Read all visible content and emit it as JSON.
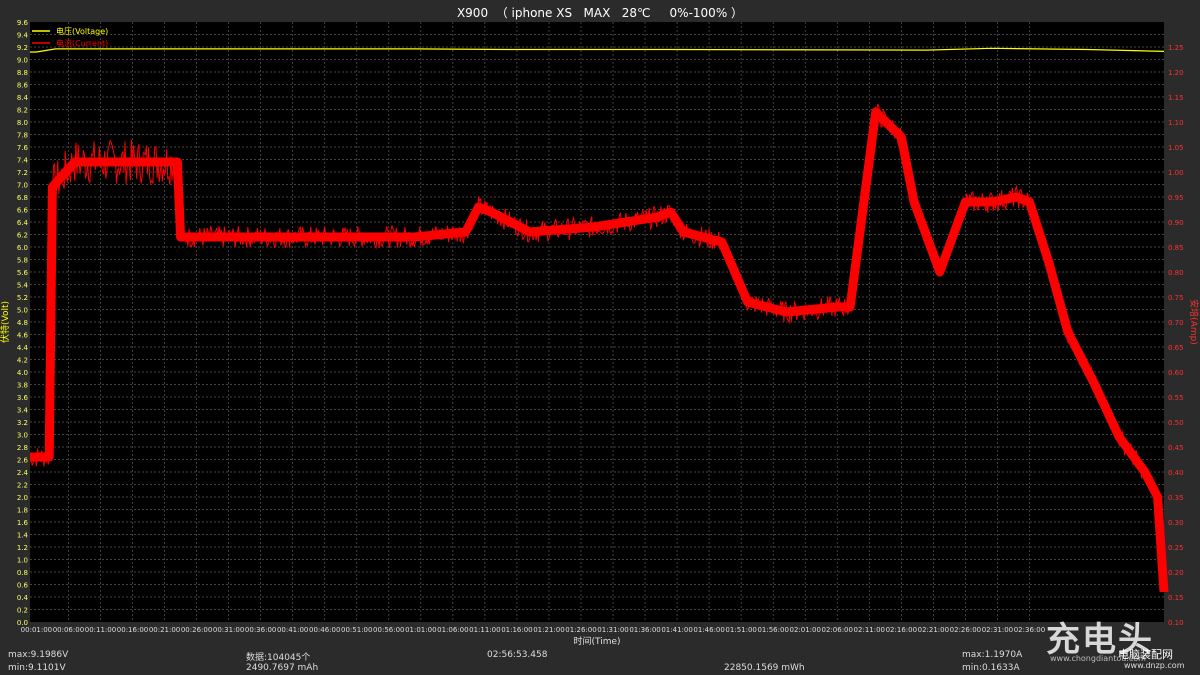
{
  "chart_data": {
    "type": "line",
    "title": "X900  （ iphone XS   MAX   28℃     0%-100% ）",
    "xlabel": "时间(Time)",
    "ylabel_left": "伏特(Volt)",
    "ylabel_right": "安培(Amp)",
    "y_left_range": [
      0,
      9.6
    ],
    "y_right_range": [
      0.1,
      1.3
    ],
    "y_left_ticks": [
      "0.0",
      "0.2",
      "0.4",
      "0.6",
      "0.8",
      "1.0",
      "1.2",
      "1.4",
      "1.6",
      "1.8",
      "2.0",
      "2.2",
      "2.4",
      "2.6",
      "2.8",
      "3.0",
      "3.2",
      "3.4",
      "3.6",
      "3.8",
      "4.0",
      "4.2",
      "4.4",
      "4.6",
      "4.8",
      "5.0",
      "5.2",
      "5.4",
      "5.6",
      "5.8",
      "6.0",
      "6.2",
      "6.4",
      "6.6",
      "6.8",
      "7.0",
      "7.2",
      "7.4",
      "7.6",
      "7.8",
      "8.0",
      "8.2",
      "8.4",
      "8.6",
      "8.8",
      "9.0",
      "9.2",
      "9.4",
      "9.6"
    ],
    "y_right_ticks": [
      "0.10",
      "0.15",
      "0.20",
      "0.25",
      "0.30",
      "0.35",
      "0.40",
      "0.45",
      "0.50",
      "0.55",
      "0.60",
      "0.65",
      "0.70",
      "0.75",
      "0.80",
      "0.85",
      "0.90",
      "0.95",
      "1.00",
      "1.05",
      "1.10",
      "1.15",
      "1.20",
      "1.25"
    ],
    "x_ticks": [
      "00:01:00",
      "00:06:00",
      "00:11:00",
      "00:16:00",
      "00:21:00",
      "00:26:00",
      "00:31:00",
      "00:36:00",
      "00:41:00",
      "00:46:00",
      "00:51:00",
      "00:56:00",
      "01:01:00",
      "01:06:00",
      "01:11:00",
      "01:16:00",
      "01:21:00",
      "01:26:00",
      "01:31:00",
      "01:36:00",
      "01:41:00",
      "01:46:00",
      "01:51:00",
      "01:56:00",
      "02:01:00",
      "02:06:00",
      "02:11:00",
      "02:16:00",
      "02:21:00",
      "02:26:00",
      "02:31:00",
      "02:36:00"
    ],
    "x_range_min": [
      0,
      177
    ],
    "grid": true,
    "legend_position": "top-left",
    "series": [
      {
        "name": "电压(Voltage)",
        "color": "#ffff00",
        "axis": "left",
        "x": [
          0,
          1,
          4,
          20,
          60,
          75,
          100,
          140,
          150,
          165,
          177
        ],
        "y": [
          9.12,
          9.12,
          9.17,
          9.17,
          9.17,
          9.16,
          9.16,
          9.15,
          9.18,
          9.16,
          9.13
        ]
      },
      {
        "name": "电流(Current)",
        "color": "#ff0000",
        "axis": "right",
        "x": [
          0,
          3,
          3.5,
          7,
          10,
          18,
          23,
          23.5,
          40,
          60,
          68,
          70,
          72,
          78,
          88,
          98,
          100,
          102,
          108,
          112,
          118,
          126,
          128,
          132,
          136,
          138,
          142,
          146,
          150,
          154,
          156,
          159,
          162,
          166,
          170,
          174,
          176,
          177
        ],
        "y": [
          0.43,
          0.43,
          0.97,
          1.02,
          1.02,
          1.02,
          1.02,
          0.87,
          0.87,
          0.87,
          0.88,
          0.93,
          0.92,
          0.88,
          0.89,
          0.91,
          0.92,
          0.88,
          0.86,
          0.74,
          0.72,
          0.73,
          0.73,
          1.12,
          1.07,
          0.94,
          0.8,
          0.94,
          0.94,
          0.95,
          0.94,
          0.82,
          0.68,
          0.58,
          0.47,
          0.4,
          0.35,
          0.16
        ]
      }
    ],
    "stats": {
      "vmax": "max:9.1986V",
      "vmin": "min:9.1101V",
      "count": "数据:104045个",
      "mah": "2490.7697 mAh",
      "duration": "02:56:53.458",
      "mwh": "22850.1569 mWh",
      "amax": "max:1.1970A",
      "amin": "min:0.1633A"
    },
    "watermark": {
      "logo": "充电头",
      "url": "www.chongdiantou.com",
      "site": "电脑装配网",
      "site_url": "www.dnzp.com"
    }
  }
}
